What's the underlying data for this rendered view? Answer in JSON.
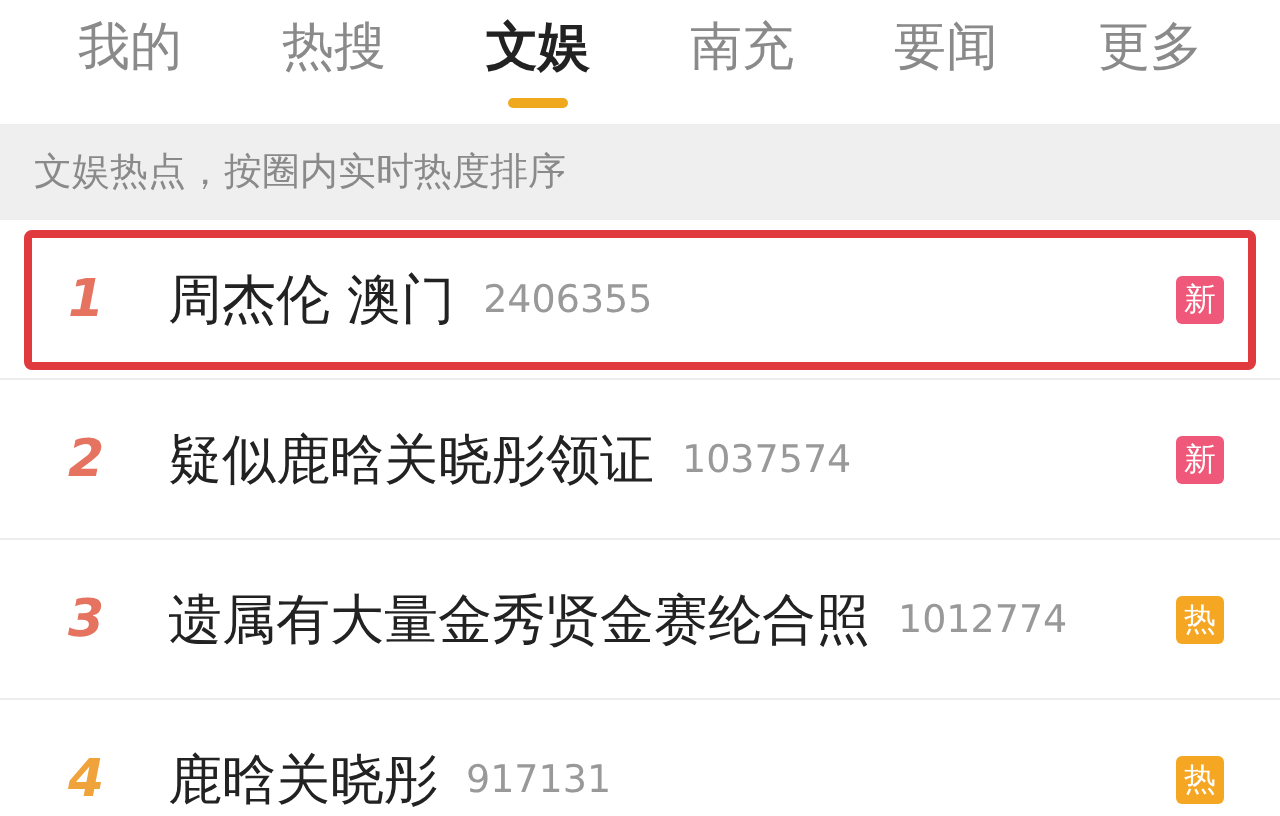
{
  "tabs": [
    {
      "label": "我的",
      "selected": false
    },
    {
      "label": "热搜",
      "selected": false
    },
    {
      "label": "文娱",
      "selected": true
    },
    {
      "label": "南充",
      "selected": false
    },
    {
      "label": "要闻",
      "selected": false
    },
    {
      "label": "更多",
      "selected": false
    }
  ],
  "subtitle": "文娱热点，按圈内实时热度排序",
  "rows": [
    {
      "rank": "1",
      "color": "#e5735f",
      "title": "周杰伦 澳门",
      "count": "2406355",
      "badge": {
        "kind": "new",
        "label": "新"
      },
      "highlighted": true
    },
    {
      "rank": "2",
      "color": "#e5735f",
      "title": "疑似鹿晗关晓彤领证",
      "count": "1037574",
      "badge": {
        "kind": "new",
        "label": "新"
      },
      "highlighted": false
    },
    {
      "rank": "3",
      "color": "#e5735f",
      "title": "遗属有大量金秀贤金赛纶合照",
      "count": "1012774",
      "badge": {
        "kind": "hot",
        "label": "热"
      },
      "highlighted": false
    },
    {
      "rank": "4",
      "color": "#f0a33b",
      "title": "鹿晗关晓彤",
      "count": "917131",
      "badge": {
        "kind": "hot",
        "label": "热"
      },
      "highlighted": false
    }
  ]
}
